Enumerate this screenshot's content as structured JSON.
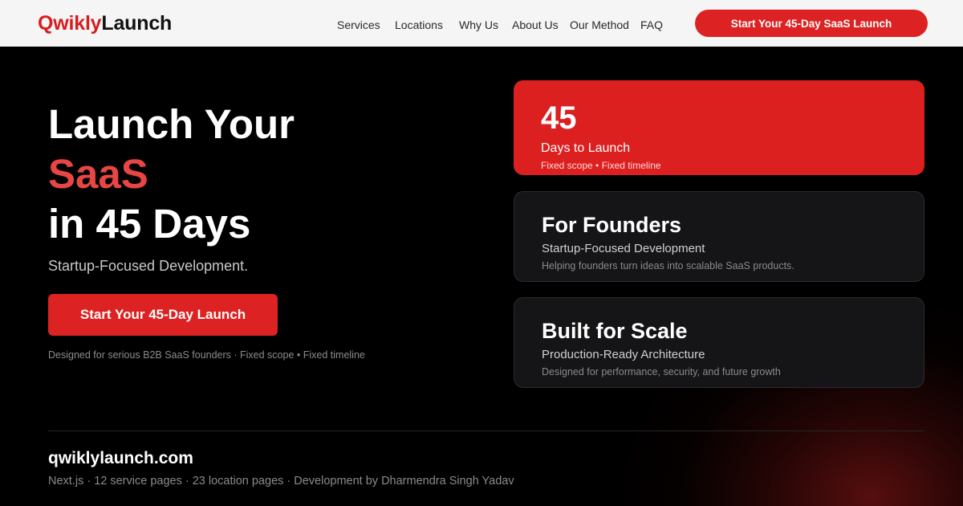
{
  "header": {
    "logo_part1": "Qwikly",
    "logo_part2": "Launch",
    "nav": [
      "Services",
      "Locations",
      "Why Us",
      "About Us",
      "Our Method",
      "FAQ"
    ],
    "cta_label": "Start Your 45-Day SaaS Launch"
  },
  "hero": {
    "title_line1": "Launch Your",
    "title_line2": "SaaS",
    "title_line3": "in 45 Days",
    "subtitle": "Startup-Focused Development.",
    "cta_label": "Start Your 45-Day Launch",
    "note": "Designed for serious B2B SaaS founders · Fixed scope • Fixed timeline"
  },
  "cards": [
    {
      "big": "45",
      "mid": "Days to Launch",
      "small": "Fixed scope • Fixed timeline"
    },
    {
      "big": "For Founders",
      "mid": "Startup-Focused Development",
      "small": "Helping founders turn ideas into scalable SaaS products."
    },
    {
      "big": "Built for Scale",
      "mid": "Production-Ready Architecture",
      "small": "Designed for performance, security, and future growth"
    }
  ],
  "footer": {
    "domain": "qwiklylaunch.com",
    "meta": "Next.js · 12 service pages · 23 location pages · Development by Dharmendra Singh Yadav"
  },
  "colors": {
    "brand_red": "#dc2222",
    "accent_text_red": "#e84545",
    "background": "#000000",
    "header_bg": "#f5f5f5",
    "card_dark": "#151517"
  }
}
